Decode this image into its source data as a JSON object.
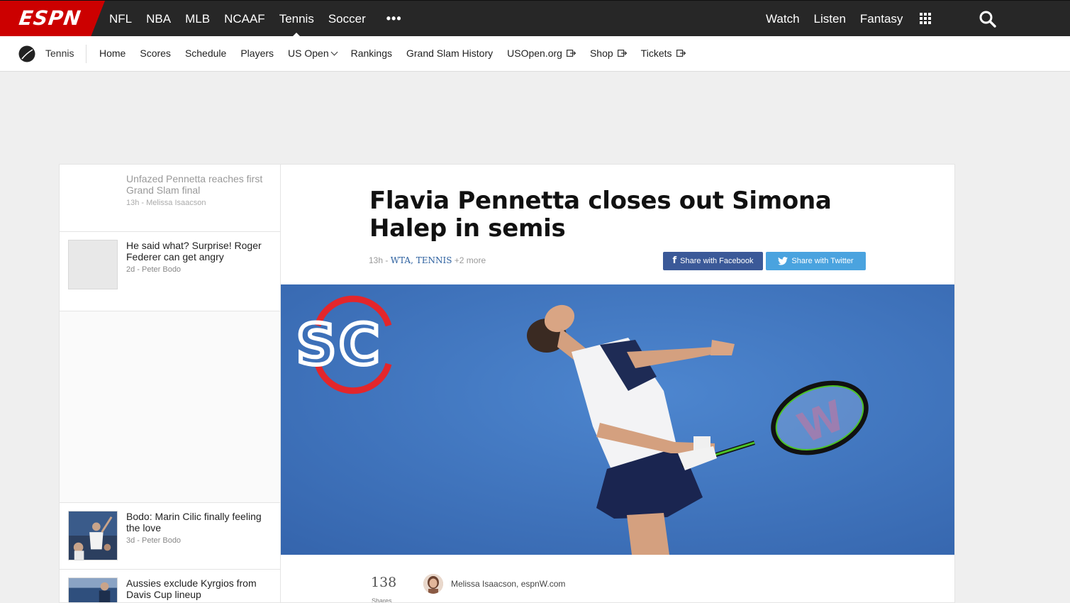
{
  "brand": {
    "logo_text": "ESPN",
    "accent": "#cc0000",
    "topbar_bg": "#272727"
  },
  "topnav": {
    "items": [
      {
        "label": "NFL"
      },
      {
        "label": "NBA"
      },
      {
        "label": "MLB"
      },
      {
        "label": "NCAAF"
      },
      {
        "label": "Tennis",
        "active": true
      },
      {
        "label": "Soccer"
      }
    ],
    "more_label": "•••",
    "right": [
      {
        "label": "Watch"
      },
      {
        "label": "Listen"
      },
      {
        "label": "Fantasy"
      }
    ],
    "grid_icon": "apps-grid-icon",
    "search_icon": "search-icon"
  },
  "subnav": {
    "sport": "Tennis",
    "sport_icon": "tennis-ball-icon",
    "items": [
      {
        "label": "Home"
      },
      {
        "label": "Scores"
      },
      {
        "label": "Schedule"
      },
      {
        "label": "Players"
      },
      {
        "label": "US Open",
        "dropdown": true
      },
      {
        "label": "Rankings"
      },
      {
        "label": "Grand Slam History"
      },
      {
        "label": "USOpen.org",
        "external": true
      },
      {
        "label": "Shop",
        "external": true
      },
      {
        "label": "Tickets",
        "external": true
      }
    ]
  },
  "rail": {
    "stories": [
      {
        "headline": "Unfazed Pennetta reaches first Grand Slam final",
        "meta": "13h - Melissa Isaacson",
        "faded": true
      },
      {
        "headline": "He said what? Surprise! Roger Federer can get angry",
        "meta": "2d - Peter Bodo"
      },
      {
        "headline": "Bodo: Marin Cilic finally feeling the love",
        "meta": "3d - Peter Bodo"
      },
      {
        "headline": "Aussies exclude Kyrgios from Davis Cup lineup",
        "meta": ""
      }
    ]
  },
  "article": {
    "title": "Flavia Pennetta closes out Simona Halep in semis",
    "time": "13h",
    "tags": [
      "WTA",
      "TENNIS"
    ],
    "more_tags": "+2 more",
    "share_facebook": "Share with Facebook",
    "share_twitter": "Share with Twitter",
    "hero_watermark": "SC",
    "shares_count": "138",
    "shares_label": "Shares",
    "author": "Melissa Isaacson, espnW.com"
  },
  "colors": {
    "facebook": "#3b5998",
    "twitter": "#4aa3df",
    "tag_link": "#2b5f9e",
    "court_blue": "#3f73bc"
  }
}
